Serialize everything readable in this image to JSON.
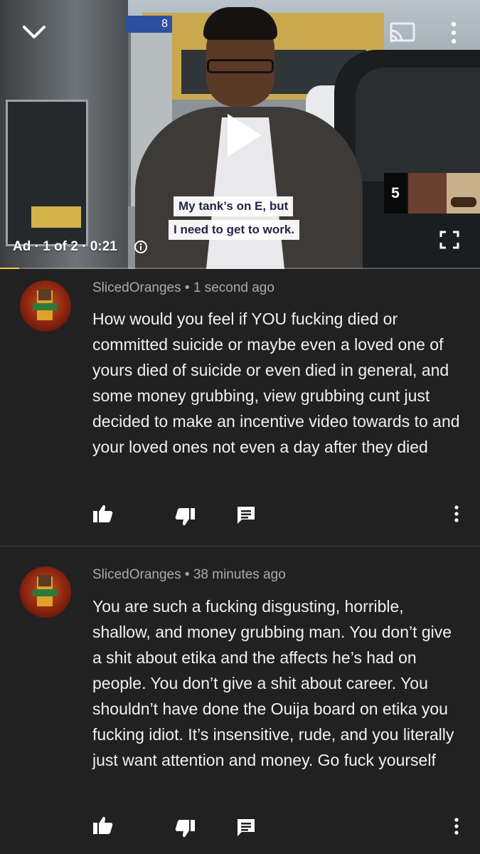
{
  "player": {
    "ad_label": "Ad · 1 of 2 · 0:21",
    "caption_line1": "My tank’s on E, but",
    "caption_line2": "I need to get to work.",
    "sign_number": "8",
    "thumbnail_count": "5",
    "progress_fraction": 0.04,
    "accent_color": "#f3c74a",
    "icons": [
      "chevron-down-icon",
      "cast-icon",
      "more-vert-icon",
      "play-icon",
      "info-icon",
      "fullscreen-icon"
    ]
  },
  "comments": [
    {
      "author": "SlicedOranges",
      "time": "1 second ago",
      "text": "How would you feel if YOU fucking died or committed suicide or maybe even a loved one of yours died of suicide or even died in general, and some money grubbing, view grubbing cunt just decided to make an incentive video towards to and your loved ones not even a day after they died"
    },
    {
      "author": "SlicedOranges",
      "time": "38 minutes ago",
      "text": "You are such a fucking disgusting, horrible, shallow, and money grubbing man. You don’t give a shit about etika and the affects he’s had on people. You don’t give a shit about career. You shouldn’t have done the Ouija board on etika you fucking idiot. It’s insensitive, rude, and you literally just want attention and money. Go fuck yourself"
    }
  ],
  "separator": "•",
  "action_icons": [
    "thumb-up-icon",
    "thumb-down-icon",
    "reply-icon",
    "more-vert-icon"
  ],
  "colors": {
    "background": "#212121",
    "meta_text": "#aaaaaa",
    "body_text": "#f1f1f1"
  }
}
